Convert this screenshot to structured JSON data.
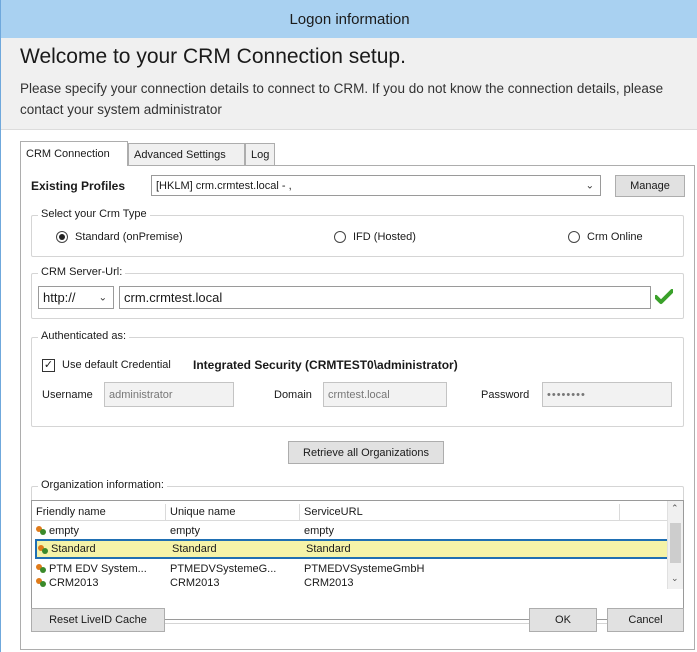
{
  "window": {
    "title": "Logon information"
  },
  "banner": {
    "heading": "Welcome to your CRM Connection setup.",
    "description": "Please specify your connection details to connect to CRM. If you do not know the connection details, please contact your system administrator"
  },
  "tabs": [
    {
      "label": "CRM Connection",
      "active": true
    },
    {
      "label": "Advanced Settings",
      "active": false
    },
    {
      "label": "Log",
      "active": false
    }
  ],
  "profiles": {
    "label": "Existing Profiles",
    "value": "[HKLM] crm.crmtest.local - ,",
    "manage_label": "Manage"
  },
  "crm_type": {
    "title": "Select your Crm Type",
    "options": [
      {
        "label": "Standard (onPremise)",
        "selected": true
      },
      {
        "label": "IFD (Hosted)",
        "selected": false
      },
      {
        "label": "Crm Online",
        "selected": false
      }
    ]
  },
  "server": {
    "title": "CRM Server-Url:",
    "protocol": "http://",
    "host": "crm.crmtest.local",
    "valid_icon": "green-checkmark-icon"
  },
  "auth": {
    "title": "Authenticated as:",
    "use_default_label": "Use default Credential",
    "use_default_checked": true,
    "identity": "Integrated Security (CRMTEST0\\administrator)",
    "username_label": "Username",
    "username_value": "administrator",
    "domain_label": "Domain",
    "domain_value": "crmtest.local",
    "password_label": "Password",
    "password_value": "••••••••"
  },
  "retrieve_label": "Retrieve all Organizations",
  "org_info": {
    "title": "Organization information:",
    "columns": [
      "Friendly name",
      "Unique name",
      "ServiceURL"
    ],
    "rows": [
      {
        "friendly": "empty",
        "unique": "empty",
        "url": "empty",
        "selected": false
      },
      {
        "friendly": "Standard",
        "unique": "Standard",
        "url": "Standard",
        "selected": true
      },
      {
        "friendly": "PTM EDV System...",
        "unique": "PTMEDVSystemeG...",
        "url": "PTMEDVSystemeGmbH",
        "selected": false
      },
      {
        "friendly": "CRM2013",
        "unique": "CRM2013",
        "url": "CRM2013",
        "selected": false
      }
    ]
  },
  "footer": {
    "reset_label": "Reset LiveID Cache",
    "ok_label": "OK",
    "cancel_label": "Cancel"
  },
  "colors": {
    "titlebar": "#a9d1f1",
    "selection_fill": "#f5f3a8",
    "selection_border": "#1f6fb3",
    "check_green": "#3aa12a"
  }
}
